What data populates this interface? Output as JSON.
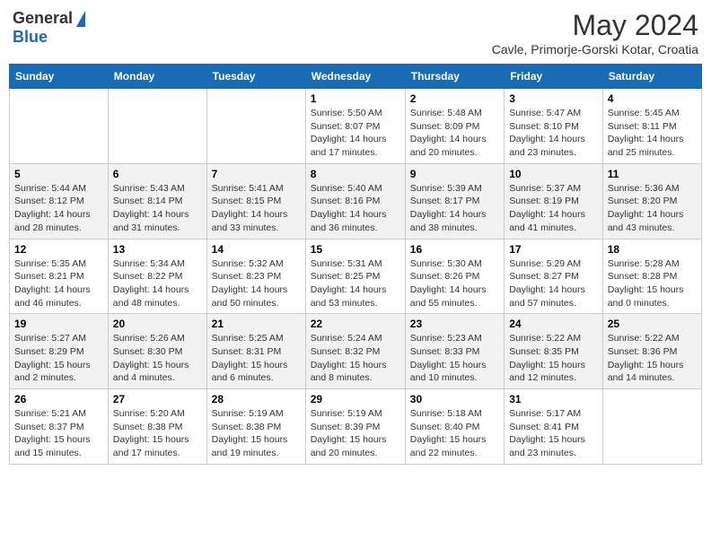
{
  "header": {
    "logo_general": "General",
    "logo_blue": "Blue",
    "month_year": "May 2024",
    "subtitle": "Cavle, Primorje-Gorski Kotar, Croatia"
  },
  "days_of_week": [
    "Sunday",
    "Monday",
    "Tuesday",
    "Wednesday",
    "Thursday",
    "Friday",
    "Saturday"
  ],
  "weeks": [
    [
      {
        "day": "",
        "info": ""
      },
      {
        "day": "",
        "info": ""
      },
      {
        "day": "",
        "info": ""
      },
      {
        "day": "1",
        "info": "Sunrise: 5:50 AM\nSunset: 8:07 PM\nDaylight: 14 hours\nand 17 minutes."
      },
      {
        "day": "2",
        "info": "Sunrise: 5:48 AM\nSunset: 8:09 PM\nDaylight: 14 hours\nand 20 minutes."
      },
      {
        "day": "3",
        "info": "Sunrise: 5:47 AM\nSunset: 8:10 PM\nDaylight: 14 hours\nand 23 minutes."
      },
      {
        "day": "4",
        "info": "Sunrise: 5:45 AM\nSunset: 8:11 PM\nDaylight: 14 hours\nand 25 minutes."
      }
    ],
    [
      {
        "day": "5",
        "info": "Sunrise: 5:44 AM\nSunset: 8:12 PM\nDaylight: 14 hours\nand 28 minutes."
      },
      {
        "day": "6",
        "info": "Sunrise: 5:43 AM\nSunset: 8:14 PM\nDaylight: 14 hours\nand 31 minutes."
      },
      {
        "day": "7",
        "info": "Sunrise: 5:41 AM\nSunset: 8:15 PM\nDaylight: 14 hours\nand 33 minutes."
      },
      {
        "day": "8",
        "info": "Sunrise: 5:40 AM\nSunset: 8:16 PM\nDaylight: 14 hours\nand 36 minutes."
      },
      {
        "day": "9",
        "info": "Sunrise: 5:39 AM\nSunset: 8:17 PM\nDaylight: 14 hours\nand 38 minutes."
      },
      {
        "day": "10",
        "info": "Sunrise: 5:37 AM\nSunset: 8:19 PM\nDaylight: 14 hours\nand 41 minutes."
      },
      {
        "day": "11",
        "info": "Sunrise: 5:36 AM\nSunset: 8:20 PM\nDaylight: 14 hours\nand 43 minutes."
      }
    ],
    [
      {
        "day": "12",
        "info": "Sunrise: 5:35 AM\nSunset: 8:21 PM\nDaylight: 14 hours\nand 46 minutes."
      },
      {
        "day": "13",
        "info": "Sunrise: 5:34 AM\nSunset: 8:22 PM\nDaylight: 14 hours\nand 48 minutes."
      },
      {
        "day": "14",
        "info": "Sunrise: 5:32 AM\nSunset: 8:23 PM\nDaylight: 14 hours\nand 50 minutes."
      },
      {
        "day": "15",
        "info": "Sunrise: 5:31 AM\nSunset: 8:25 PM\nDaylight: 14 hours\nand 53 minutes."
      },
      {
        "day": "16",
        "info": "Sunrise: 5:30 AM\nSunset: 8:26 PM\nDaylight: 14 hours\nand 55 minutes."
      },
      {
        "day": "17",
        "info": "Sunrise: 5:29 AM\nSunset: 8:27 PM\nDaylight: 14 hours\nand 57 minutes."
      },
      {
        "day": "18",
        "info": "Sunrise: 5:28 AM\nSunset: 8:28 PM\nDaylight: 15 hours\nand 0 minutes."
      }
    ],
    [
      {
        "day": "19",
        "info": "Sunrise: 5:27 AM\nSunset: 8:29 PM\nDaylight: 15 hours\nand 2 minutes."
      },
      {
        "day": "20",
        "info": "Sunrise: 5:26 AM\nSunset: 8:30 PM\nDaylight: 15 hours\nand 4 minutes."
      },
      {
        "day": "21",
        "info": "Sunrise: 5:25 AM\nSunset: 8:31 PM\nDaylight: 15 hours\nand 6 minutes."
      },
      {
        "day": "22",
        "info": "Sunrise: 5:24 AM\nSunset: 8:32 PM\nDaylight: 15 hours\nand 8 minutes."
      },
      {
        "day": "23",
        "info": "Sunrise: 5:23 AM\nSunset: 8:33 PM\nDaylight: 15 hours\nand 10 minutes."
      },
      {
        "day": "24",
        "info": "Sunrise: 5:22 AM\nSunset: 8:35 PM\nDaylight: 15 hours\nand 12 minutes."
      },
      {
        "day": "25",
        "info": "Sunrise: 5:22 AM\nSunset: 8:36 PM\nDaylight: 15 hours\nand 14 minutes."
      }
    ],
    [
      {
        "day": "26",
        "info": "Sunrise: 5:21 AM\nSunset: 8:37 PM\nDaylight: 15 hours\nand 15 minutes."
      },
      {
        "day": "27",
        "info": "Sunrise: 5:20 AM\nSunset: 8:38 PM\nDaylight: 15 hours\nand 17 minutes."
      },
      {
        "day": "28",
        "info": "Sunrise: 5:19 AM\nSunset: 8:38 PM\nDaylight: 15 hours\nand 19 minutes."
      },
      {
        "day": "29",
        "info": "Sunrise: 5:19 AM\nSunset: 8:39 PM\nDaylight: 15 hours\nand 20 minutes."
      },
      {
        "day": "30",
        "info": "Sunrise: 5:18 AM\nSunset: 8:40 PM\nDaylight: 15 hours\nand 22 minutes."
      },
      {
        "day": "31",
        "info": "Sunrise: 5:17 AM\nSunset: 8:41 PM\nDaylight: 15 hours\nand 23 minutes."
      },
      {
        "day": "",
        "info": ""
      }
    ]
  ]
}
